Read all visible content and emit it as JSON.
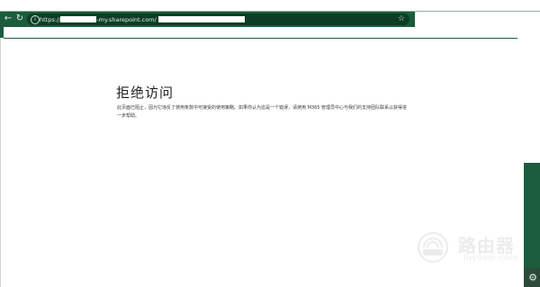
{
  "browser": {
    "url_prefix": "https://",
    "url_domain": "-my.sharepoint.com/"
  },
  "page": {
    "title": "拒绝访问",
    "message": "此页面已阻止，因为它违反了使用条款中可接受的使用策略。如果你认为这是一个错误，请使用 M365 管理员中心与我们的支持团队联系以获得进一步帮助。"
  },
  "watermark": {
    "name": "路由器",
    "domain": "luyouqi.com"
  },
  "colors": {
    "accent_green": "#1a5c3b",
    "dark_green": "#0d3d25"
  },
  "icons": {
    "back": "back-arrow-icon",
    "refresh": "refresh-icon",
    "site_info": "info-icon",
    "favorite": "star-icon",
    "settings": "gear-icon"
  }
}
